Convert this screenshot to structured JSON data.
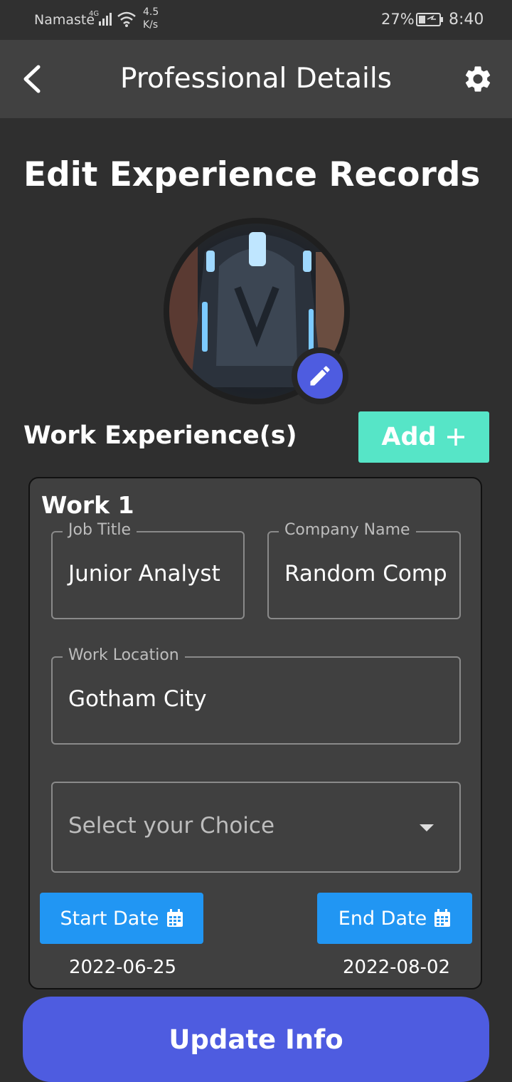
{
  "status_bar": {
    "carrier": "Namaste",
    "network": "4G",
    "speed_value": "4.5",
    "speed_unit": "K/s",
    "battery": "27%",
    "time": "8:40",
    "icons": [
      "signal-icon",
      "wifi-icon",
      "battery-icon"
    ]
  },
  "app_bar": {
    "title": "Professional Details",
    "back_icon": "back-arrow-icon",
    "settings_icon": "gear-icon"
  },
  "page": {
    "heading": "Edit Experience Records",
    "work_experience_label": "Work Experience(s)",
    "add_label": "Add"
  },
  "work_entry": {
    "title": "Work 1",
    "job_title_label": "Job Title",
    "job_title_value": "Junior Analyst",
    "company_label": "Company Name",
    "company_value": "Random Comp",
    "location_label": "Work Location",
    "location_value": "Gotham City",
    "select_placeholder": "Select your Choice",
    "start_date_label": "Start Date",
    "start_date_value": "2022-06-25",
    "end_date_label": "End Date",
    "end_date_value": "2022-08-02"
  },
  "actions": {
    "update_label": "Update Info"
  },
  "colors": {
    "accent": "#4e5ce0",
    "add_button": "#56e5c7",
    "date_button": "#2196f3",
    "background": "#2f2f2f",
    "app_bar": "#414141",
    "card": "#404040"
  }
}
